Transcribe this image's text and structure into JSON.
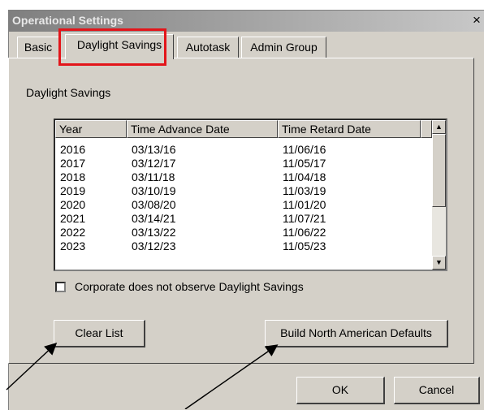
{
  "window": {
    "title": "Operational Settings",
    "close_glyph": "×"
  },
  "tabs": [
    {
      "label": "Basic",
      "active": false
    },
    {
      "label": "Daylight Savings",
      "active": true
    },
    {
      "label": "Autotask",
      "active": false
    },
    {
      "label": "Admin Group",
      "active": false
    }
  ],
  "group_label": "Daylight Savings",
  "list": {
    "columns": [
      "Year",
      "Time Advance Date",
      "Time Retard Date"
    ],
    "rows": [
      [
        "2016",
        "03/13/16",
        "11/06/16"
      ],
      [
        "2017",
        "03/12/17",
        "11/05/17"
      ],
      [
        "2018",
        "03/11/18",
        "11/04/18"
      ],
      [
        "2019",
        "03/10/19",
        "11/03/19"
      ],
      [
        "2020",
        "03/08/20",
        "11/01/20"
      ],
      [
        "2021",
        "03/14/21",
        "11/07/21"
      ],
      [
        "2022",
        "03/13/22",
        "11/06/22"
      ],
      [
        "2023",
        "03/12/23",
        "11/05/23"
      ]
    ]
  },
  "checkbox": {
    "label": "Corporate does not observe Daylight Savings",
    "checked": false
  },
  "buttons": {
    "clear_list": "Clear List",
    "build_defaults": "Build North American Defaults",
    "ok": "OK",
    "cancel": "Cancel"
  },
  "colors": {
    "highlight": "#e3151a",
    "dialog_bg": "#d4d0c8"
  },
  "icons": {
    "scroll_up": "scroll-up-arrow-icon",
    "scroll_down": "scroll-down-arrow-icon"
  }
}
